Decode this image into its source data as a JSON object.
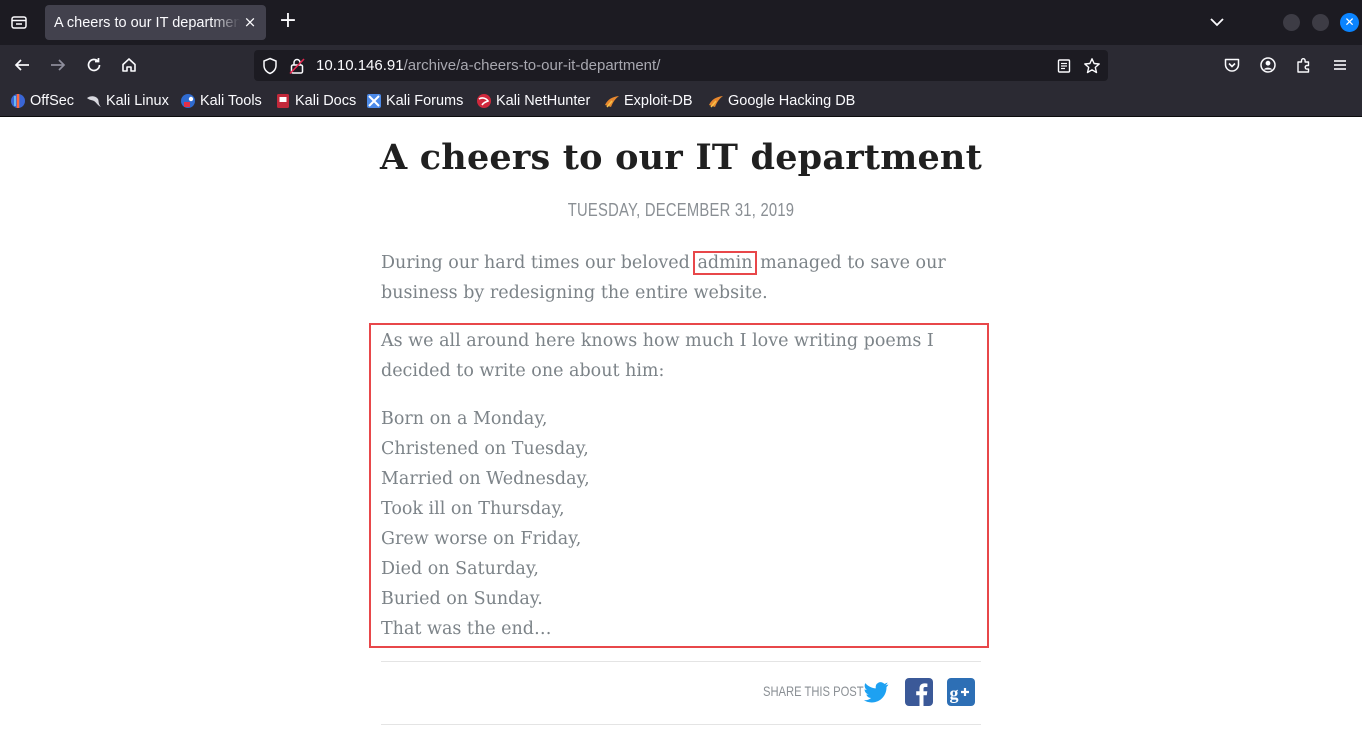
{
  "browser": {
    "tab_title": "A cheers to our IT department",
    "tab_close": "×",
    "new_tab": "+",
    "url_host": "10.10.146.91",
    "url_path": "/archive/a-cheers-to-our-it-department/",
    "window_close": "✕",
    "bookmarks": [
      {
        "label": "OffSec",
        "icon": "offsec-icon"
      },
      {
        "label": "Kali Linux",
        "icon": "kali-dragon-icon"
      },
      {
        "label": "Kali Tools",
        "icon": "kali-tools-icon"
      },
      {
        "label": "Kali Docs",
        "icon": "kali-docs-icon"
      },
      {
        "label": "Kali Forums",
        "icon": "kali-forums-icon"
      },
      {
        "label": "Kali NetHunter",
        "icon": "kali-nethunter-icon"
      },
      {
        "label": "Exploit-DB",
        "icon": "exploit-db-icon"
      },
      {
        "label": "Google Hacking DB",
        "icon": "ghdb-icon"
      }
    ]
  },
  "post": {
    "title": "A cheers to our IT department",
    "date": "TUESDAY, DECEMBER 31, 2019",
    "p1_before": "During our hard times our beloved",
    "p1_highlight": "admin",
    "p1_after": "managed to save our business by redesigning the entire website.",
    "p2": "As we all around here knows how much I love writing poems I decided to write one about him:",
    "poem": [
      "Born on a Monday,",
      "Christened on Tuesday,",
      "Married on Wednesday,",
      "Took ill on Thursday,",
      "Grew worse on Friday,",
      "Died on Saturday,",
      "Buried on Sunday.",
      "That was the end…"
    ],
    "share_label": "SHARE THIS POST"
  },
  "colors": {
    "highlight_box": "#e8474a",
    "twitter": "#1da1f2",
    "facebook": "#3b5998",
    "google_plus": "#2d6fb5"
  }
}
